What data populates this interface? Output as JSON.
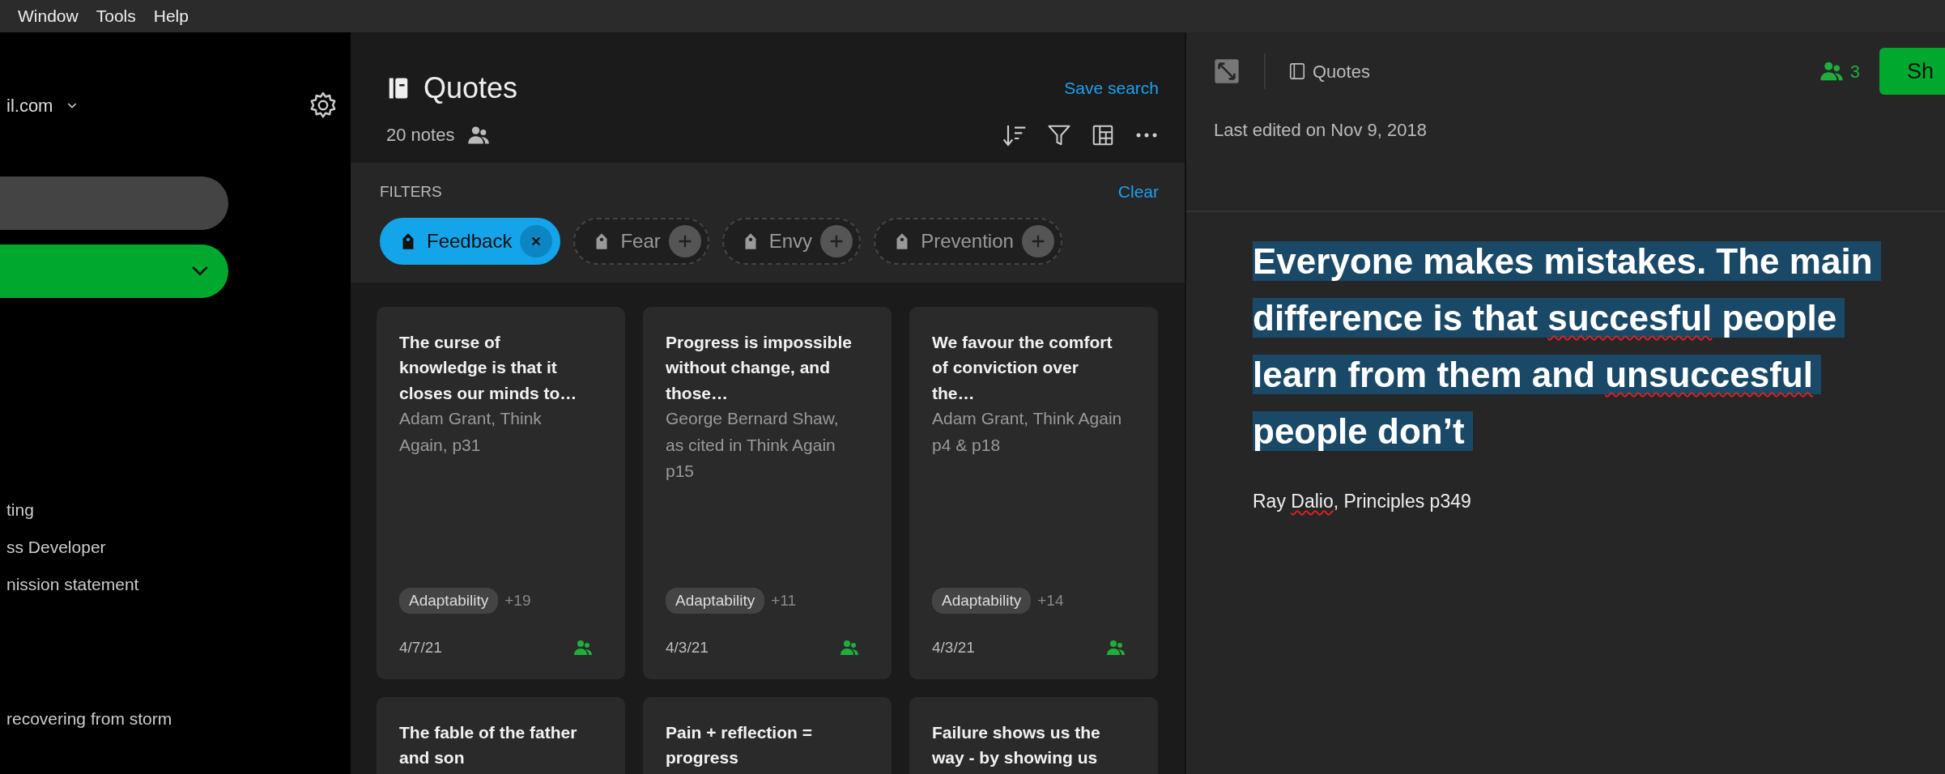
{
  "menu": [
    "Window",
    "Tools",
    "Help"
  ],
  "sidebar": {
    "account": "il.com",
    "items": [
      "ting",
      "ss Developer",
      "nission statement",
      "recovering from storm"
    ]
  },
  "notebook": {
    "title": "Quotes",
    "save_search": "Save search",
    "note_count": "20 notes",
    "filters_label": "FILTERS",
    "clear": "Clear",
    "filters": [
      {
        "label": "Feedback",
        "selected": true
      },
      {
        "label": "Fear",
        "selected": false
      },
      {
        "label": "Envy",
        "selected": false
      },
      {
        "label": "Prevention",
        "selected": false
      }
    ],
    "cards": [
      {
        "title": "The curse of knowledge is that it closes our minds to…",
        "author": "Adam Grant, Think Again, p31",
        "tag": "Adaptability",
        "more": "+19",
        "date": "4/7/21",
        "shared": true
      },
      {
        "title": "Progress is impossible without change, and those…",
        "author": "George Bernard Shaw, as cited in Think Again p15",
        "tag": "Adaptability",
        "more": "+11",
        "date": "4/3/21",
        "shared": true
      },
      {
        "title": "We favour the comfort of conviction over the…",
        "author": "Adam Grant, Think Again p4 & p18",
        "tag": "Adaptability",
        "more": "+14",
        "date": "4/3/21",
        "shared": true
      },
      {
        "title": "The fable of the father and son"
      },
      {
        "title": "Pain + reflection = progress"
      },
      {
        "title": "Failure shows us the way - by showing us"
      }
    ]
  },
  "note": {
    "notebook": "Quotes",
    "shared_count": "3",
    "share_button": "Sh",
    "last_edited": "Last edited on Nov 9, 2018",
    "quote": [
      {
        "text": "Everyone makes mistakes. The main difference is that ",
        "misspelled": false
      },
      {
        "text": "succesful",
        "misspelled": true
      },
      {
        "text": " people learn from them and ",
        "misspelled": false
      },
      {
        "text": "unsuccesful",
        "misspelled": true
      },
      {
        "text": " people don’t",
        "misspelled": false
      }
    ],
    "source": [
      {
        "text": "Ray ",
        "misspelled": false
      },
      {
        "text": "Dalio",
        "misspelled": true
      },
      {
        "text": ", Principles p349",
        "misspelled": false
      }
    ]
  }
}
